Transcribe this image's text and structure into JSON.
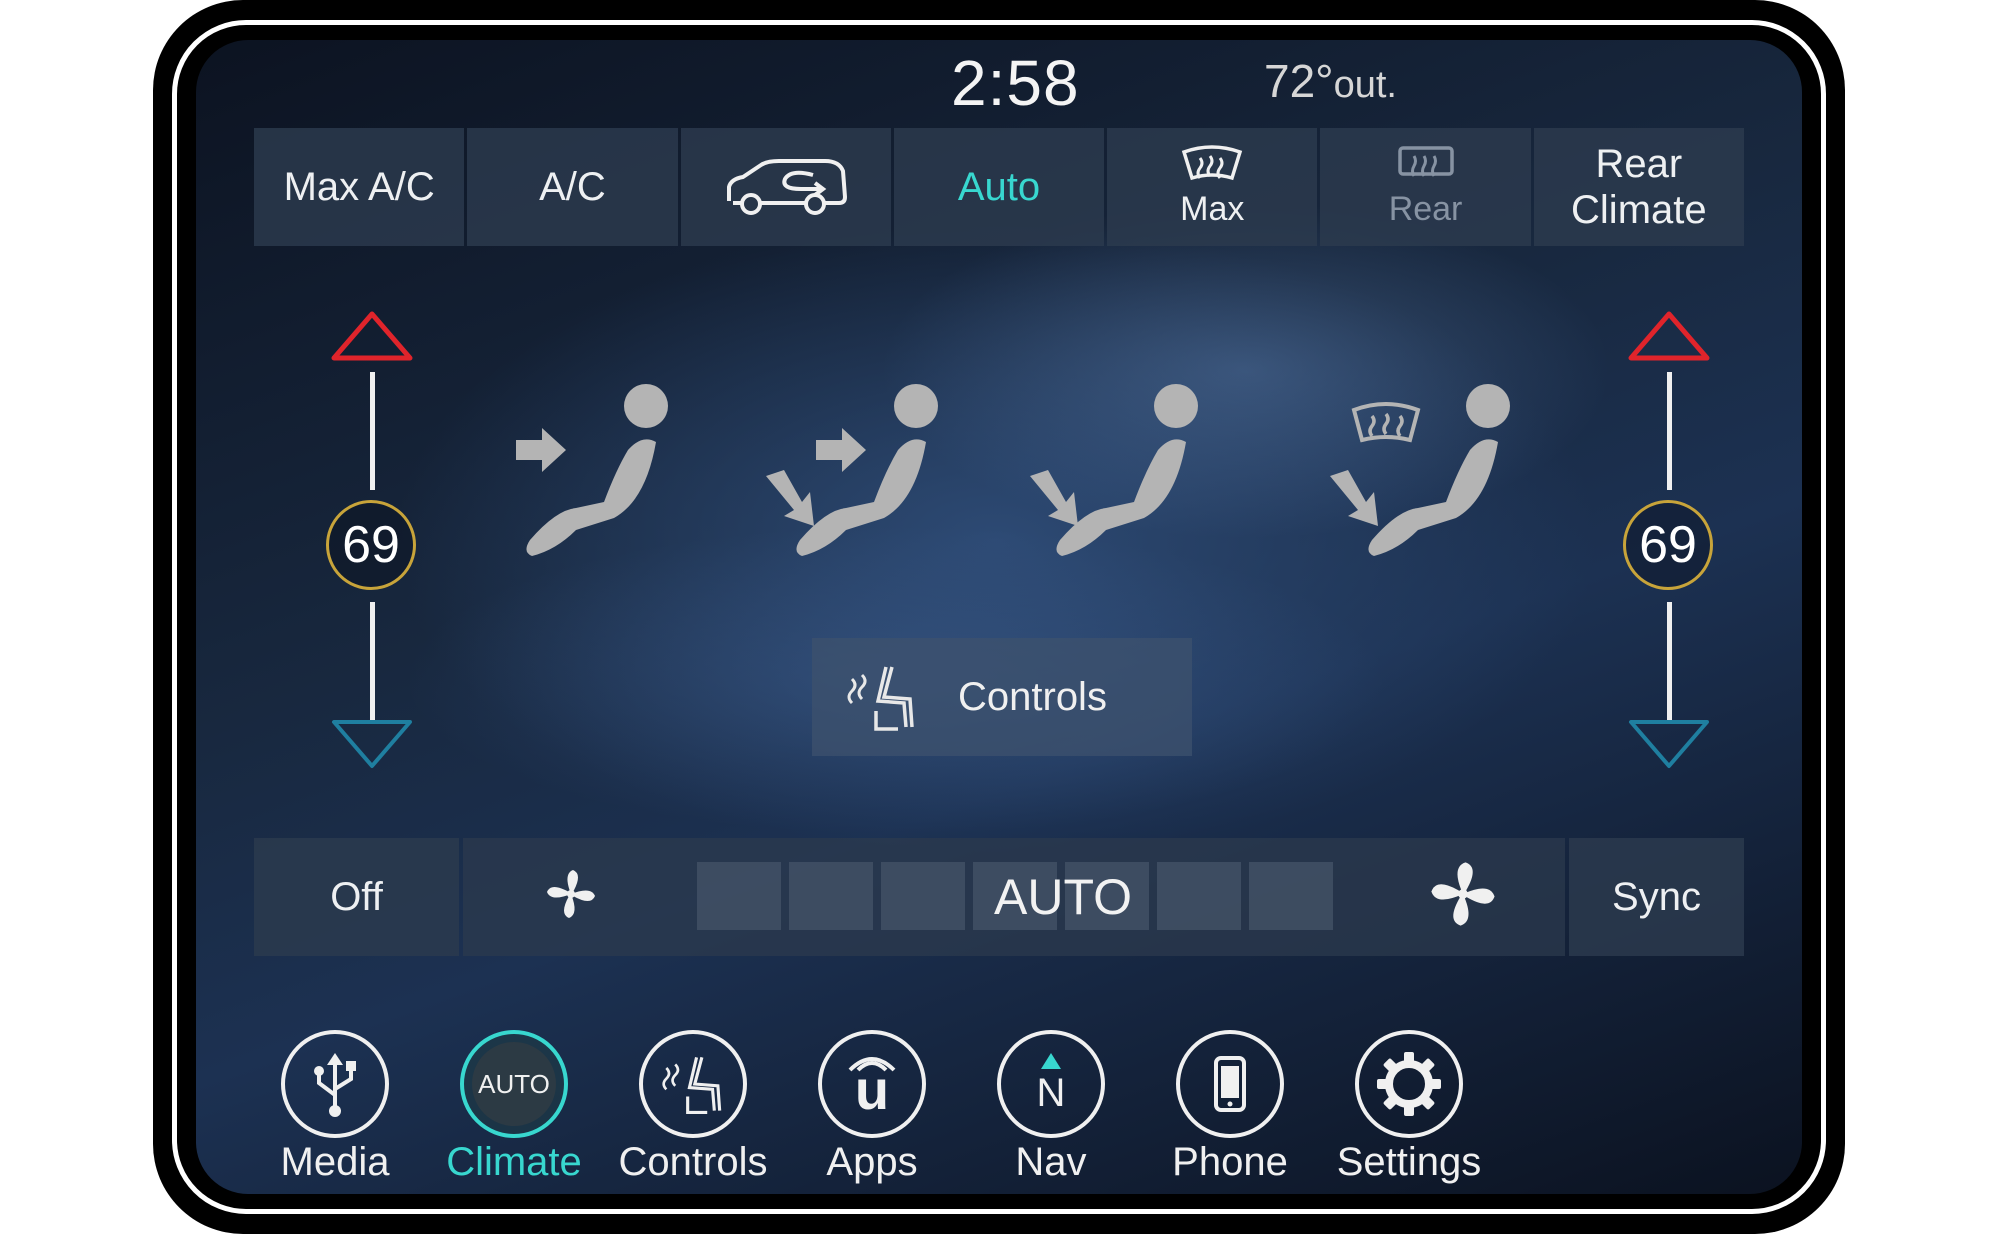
{
  "status": {
    "time": "2:58",
    "outside_temp": "72°",
    "outside_unit": "out."
  },
  "top_buttons": {
    "max_ac": "Max A/C",
    "ac": "A/C",
    "recirc_icon": "car-recirculation-icon",
    "auto": "Auto",
    "max_defrost": "Max",
    "rear_defrost": "Rear",
    "rear_climate_line1": "Rear",
    "rear_climate_line2": "Climate"
  },
  "temperature": {
    "driver": "69",
    "passenger": "69"
  },
  "modes": [
    "airflow-panel-icon",
    "airflow-bilevel-icon",
    "airflow-floor-icon",
    "airflow-floor-defrost-icon"
  ],
  "seat_controls": {
    "label": "Controls",
    "icon": "heated-seat-icon"
  },
  "fan": {
    "off": "Off",
    "auto": "AUTO",
    "sync": "Sync",
    "low_icon": "fan-low-icon",
    "high_icon": "fan-high-icon"
  },
  "nav": [
    {
      "label": "Media",
      "icon": "usb-icon"
    },
    {
      "label": "Climate",
      "icon": "climate-auto-icon",
      "badge": "AUTO",
      "active": true
    },
    {
      "label": "Controls",
      "icon": "heated-seat-icon"
    },
    {
      "label": "Apps",
      "icon": "uconnect-icon",
      "glyph": "u"
    },
    {
      "label": "Nav",
      "icon": "compass-icon",
      "glyph": "N"
    },
    {
      "label": "Phone",
      "icon": "phone-icon"
    },
    {
      "label": "Settings",
      "icon": "gear-icon"
    }
  ],
  "colors": {
    "accent": "#38d7cf",
    "temp_up": "#e0242b",
    "temp_down": "#1f7fa0",
    "temp_ring": "#c8a43a"
  }
}
